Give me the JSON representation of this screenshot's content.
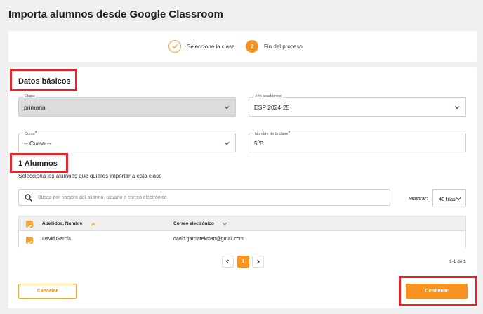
{
  "page": {
    "title": "Importa alumnos desde Google Classroom"
  },
  "stepper": {
    "steps": [
      {
        "label": "Selecciona la clase",
        "number": "",
        "state": "done"
      },
      {
        "label": "Fin del proceso",
        "number": "2",
        "state": "active"
      }
    ]
  },
  "basics": {
    "title": "Datos básicos",
    "etapa": {
      "label": "Etapa",
      "value": "primaria"
    },
    "anio": {
      "label": "Año académico",
      "value": "ESP 2024-25"
    },
    "curso": {
      "label": "Curso",
      "required_mark": "*",
      "value": "-- Curso --"
    },
    "nombre": {
      "label": "Nombre de la clase",
      "required_mark": "*",
      "value": "5ºB"
    }
  },
  "students": {
    "title": "1 Alumnos",
    "subtitle": "Selecciona los alumnos que quieres importar a esta clase",
    "search_placeholder": "Busca por nombre del alumno, usuario o correo electrónico",
    "show_label": "Mostrar:",
    "show_value": "40 filas",
    "columns": [
      "Apellidos, Nombre",
      "Correo electrónico"
    ],
    "rows": [
      {
        "name": "David García",
        "email": "david.garciatekman@gmail.com"
      }
    ],
    "pagination": {
      "current": "1",
      "range_text": "1-1 de ",
      "total": "1"
    }
  },
  "actions": {
    "cancel": "Cancelar",
    "continue": "Continuar"
  },
  "colors": {
    "accent": "#f7931e",
    "highlight": "#e4262a"
  }
}
